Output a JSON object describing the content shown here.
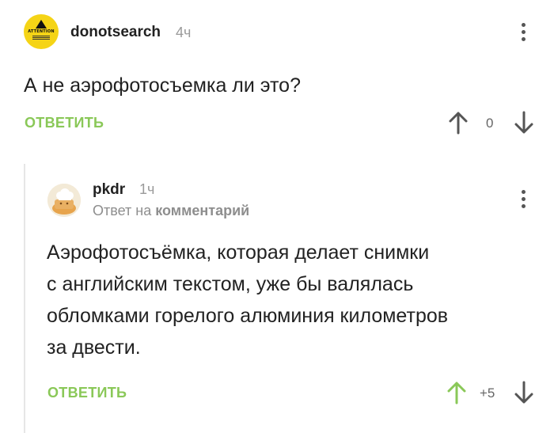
{
  "comment1": {
    "username": "donotsearch",
    "time": "4ч",
    "avatar_text": "ATTENTION",
    "text": "А не аэрофотосъемка ли это?",
    "reply_label": "ОТВЕТИТЬ",
    "score": "0"
  },
  "comment2": {
    "username": "pkdr",
    "time": "1ч",
    "subtitle_prefix": "Ответ на",
    "subtitle_link": "комментарий",
    "text_lines": [
      "Аэрофотосъёмка, которая делает снимки",
      "с английским текстом, уже бы валялась",
      "обломками горелого алюминия километров",
      "за двести."
    ],
    "reply_label": "ОТВЕТИТЬ",
    "score": "+5"
  },
  "colors": {
    "reply_green": "#8ac858",
    "upvote_active": "#8ac858",
    "neutral_arrow": "#555555",
    "avatar1_bg": "#f5d416"
  },
  "icons": {
    "upvote": "arrow-up-icon",
    "downvote": "arrow-down-icon",
    "menu": "vertical-dots-icon"
  }
}
